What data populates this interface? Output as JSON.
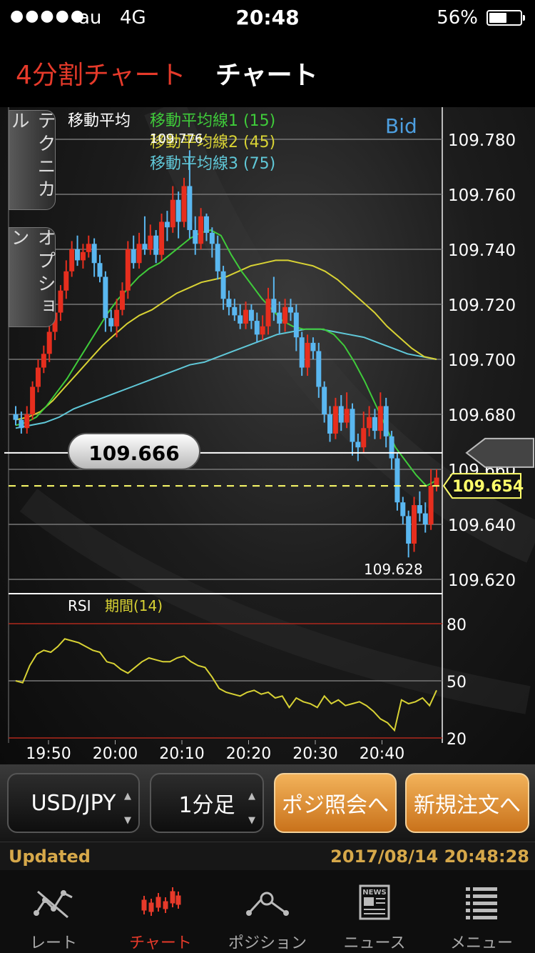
{
  "status_bar": {
    "signal": "●●●●●",
    "carrier": "au",
    "network": "4G",
    "time": "20:48",
    "battery": "56%",
    "battery_level": 0.56
  },
  "header": {
    "tab_split": "4分割チャート",
    "title": "チャート"
  },
  "side_tabs": [
    "テクニカル",
    "オプション"
  ],
  "chart": {
    "legend_prefix": "移動平均",
    "ma1": "移動平均線1 (15)",
    "ma2": "移動平均線2 (45)",
    "ma3": "移動平均線3 (75)",
    "bid_label": "Bid",
    "price_ticks": [
      "109.780",
      "109.760",
      "109.740",
      "109.720",
      "109.700",
      "109.680",
      "109.660",
      "109.640",
      "109.620"
    ],
    "high_label": "109.776",
    "low_label": "109.628",
    "crosshair_price": "109.666",
    "current_price": "109.654",
    "rsi_label": "RSI",
    "rsi_period": "期間(14)",
    "rsi_ticks": [
      "80",
      "50",
      "20"
    ],
    "time_ticks": [
      "19:50",
      "20:00",
      "20:10",
      "20:20",
      "20:30",
      "20:40"
    ],
    "colors": {
      "up": "#e62e1e",
      "down": "#5ab7f0",
      "ma1": "#3fcb3a",
      "ma2": "#d8d234",
      "ma3": "#60c8d8",
      "rsi": "#d8d234"
    }
  },
  "chart_data": {
    "type": "candlestick",
    "ylim": [
      109.615,
      109.79
    ],
    "rsi_ylim": [
      20,
      80
    ],
    "candles": [
      [
        109.68,
        109.678,
        109.683,
        109.676
      ],
      [
        109.678,
        109.675,
        109.681,
        109.673
      ],
      [
        109.675,
        109.68,
        109.683,
        109.673
      ],
      [
        109.68,
        109.69,
        109.692,
        109.678
      ],
      [
        109.69,
        109.697,
        109.7,
        109.688
      ],
      [
        109.697,
        109.702,
        109.705,
        109.695
      ],
      [
        109.702,
        109.71,
        109.712,
        109.699
      ],
      [
        109.71,
        109.717,
        109.72,
        109.707
      ],
      [
        109.717,
        109.725,
        109.727,
        109.714
      ],
      [
        109.725,
        109.732,
        109.736,
        109.722
      ],
      [
        109.732,
        109.74,
        109.743,
        109.73
      ],
      [
        109.74,
        109.736,
        109.745,
        109.734
      ],
      [
        109.736,
        109.739,
        109.742,
        109.733
      ],
      [
        109.739,
        109.742,
        109.745,
        109.737
      ],
      [
        109.742,
        109.735,
        109.744,
        109.73
      ],
      [
        109.735,
        109.73,
        109.738,
        109.728
      ],
      [
        109.73,
        109.715,
        109.732,
        109.71
      ],
      [
        109.715,
        109.712,
        109.718,
        109.71
      ],
      [
        109.712,
        109.718,
        109.722,
        109.708
      ],
      [
        109.718,
        109.725,
        109.728,
        109.716
      ],
      [
        109.725,
        109.74,
        109.743,
        109.722
      ],
      [
        109.74,
        109.735,
        109.745,
        109.733
      ],
      [
        109.735,
        109.742,
        109.746,
        109.733
      ],
      [
        109.742,
        109.74,
        109.752,
        109.738
      ],
      [
        109.74,
        109.745,
        109.749,
        109.738
      ],
      [
        109.745,
        109.738,
        109.747,
        109.735
      ],
      [
        109.738,
        109.75,
        109.753,
        109.736
      ],
      [
        109.75,
        109.748,
        109.754,
        109.743
      ],
      [
        109.748,
        109.758,
        109.763,
        109.746
      ],
      [
        109.758,
        109.75,
        109.761,
        109.744
      ],
      [
        109.75,
        109.763,
        109.766,
        109.748
      ],
      [
        109.763,
        109.747,
        109.776,
        109.744
      ],
      [
        109.747,
        109.742,
        109.752,
        109.738
      ],
      [
        109.742,
        109.752,
        109.755,
        109.74
      ],
      [
        109.752,
        109.746,
        109.753,
        109.743
      ],
      [
        109.746,
        109.742,
        109.748,
        109.737
      ],
      [
        109.742,
        109.732,
        109.745,
        109.729
      ],
      [
        109.732,
        109.722,
        109.734,
        109.718
      ],
      [
        109.722,
        109.719,
        109.725,
        109.716
      ],
      [
        109.719,
        109.716,
        109.722,
        109.714
      ],
      [
        109.716,
        109.713,
        109.72,
        109.711
      ],
      [
        109.713,
        109.718,
        109.721,
        109.711
      ],
      [
        109.718,
        109.714,
        109.72,
        109.711
      ],
      [
        109.714,
        109.709,
        109.717,
        109.706
      ],
      [
        109.709,
        109.712,
        109.716,
        109.707
      ],
      [
        109.712,
        109.722,
        109.726,
        109.709
      ],
      [
        109.722,
        109.717,
        109.73,
        109.714
      ],
      [
        109.717,
        109.713,
        109.721,
        109.709
      ],
      [
        109.713,
        109.719,
        109.722,
        109.71
      ],
      [
        109.719,
        109.717,
        109.722,
        109.714
      ],
      [
        109.717,
        109.708,
        109.72,
        109.703
      ],
      [
        109.708,
        109.697,
        109.71,
        109.694
      ],
      [
        109.697,
        109.706,
        109.709,
        109.694
      ],
      [
        109.706,
        109.703,
        109.708,
        109.7
      ],
      [
        109.703,
        109.69,
        109.706,
        109.686
      ],
      [
        109.69,
        109.68,
        109.692,
        109.677
      ],
      [
        109.68,
        109.673,
        109.683,
        109.67
      ],
      [
        109.673,
        109.683,
        109.686,
        109.671
      ],
      [
        109.683,
        109.677,
        109.687,
        109.674
      ],
      [
        109.677,
        109.682,
        109.688,
        109.675
      ],
      [
        109.682,
        109.67,
        109.684,
        109.665
      ],
      [
        109.67,
        109.668,
        109.673,
        109.663
      ],
      [
        109.668,
        109.675,
        109.681,
        109.666
      ],
      [
        109.675,
        109.679,
        109.683,
        109.672
      ],
      [
        109.679,
        109.674,
        109.682,
        109.671
      ],
      [
        109.674,
        109.683,
        109.688,
        109.671
      ],
      [
        109.683,
        109.672,
        109.686,
        109.668
      ],
      [
        109.672,
        109.664,
        109.674,
        109.66
      ],
      [
        109.664,
        109.648,
        109.666,
        109.645
      ],
      [
        109.648,
        109.643,
        109.65,
        109.64
      ],
      [
        109.643,
        109.633,
        109.645,
        109.628
      ],
      [
        109.633,
        109.647,
        109.65,
        109.63
      ],
      [
        109.647,
        109.644,
        109.652,
        109.641
      ],
      [
        109.644,
        109.64,
        109.648,
        109.637
      ],
      [
        109.64,
        109.654,
        109.66,
        109.638
      ],
      [
        109.654,
        109.657,
        109.66,
        109.652
      ]
    ],
    "ma1": [
      109.676,
      109.677,
      109.679,
      109.683,
      109.688,
      109.693,
      109.699,
      109.705,
      109.711,
      109.717,
      109.722,
      109.726,
      109.73,
      109.733,
      109.735,
      109.738,
      109.741,
      109.744,
      109.746,
      109.747,
      109.745,
      109.738,
      109.732,
      109.727,
      109.722,
      109.718,
      109.714,
      109.712,
      109.711,
      109.711,
      109.711,
      109.709,
      109.705,
      109.699,
      109.692,
      109.684,
      109.676,
      109.668,
      109.663,
      109.658,
      109.654,
      109.656
    ],
    "ma2": [
      109.678,
      109.679,
      109.681,
      109.685,
      109.69,
      109.695,
      109.7,
      109.705,
      109.709,
      109.713,
      109.716,
      109.718,
      109.721,
      109.724,
      109.726,
      109.728,
      109.729,
      109.73,
      109.732,
      109.734,
      109.735,
      109.736,
      109.736,
      109.735,
      109.734,
      109.732,
      109.729,
      109.725,
      109.721,
      109.717,
      109.712,
      109.708,
      109.704,
      109.701,
      109.7
    ],
    "ma3": [
      109.675,
      109.676,
      109.677,
      109.679,
      109.682,
      109.684,
      109.686,
      109.688,
      109.69,
      109.692,
      109.694,
      109.696,
      109.698,
      109.699,
      109.701,
      109.703,
      109.705,
      109.707,
      109.709,
      109.71,
      109.711,
      109.711,
      109.71,
      109.709,
      109.708,
      109.706,
      109.704,
      109.702,
      109.701,
      109.7
    ],
    "rsi": [
      50,
      49,
      58,
      64,
      66,
      65,
      68,
      72,
      71,
      70,
      68,
      66,
      65,
      60,
      59,
      56,
      54,
      57,
      60,
      62,
      61,
      60,
      60,
      62,
      63,
      60,
      58,
      57,
      52,
      46,
      44,
      43,
      42,
      44,
      45,
      43,
      44,
      41,
      42,
      36,
      41,
      39,
      38,
      36,
      42,
      38,
      40,
      37,
      38,
      39,
      37,
      34,
      30,
      28,
      24,
      40,
      38,
      39,
      41,
      37,
      45
    ]
  },
  "controls": {
    "pair": "USD/JPY",
    "timeframe": "1分足",
    "position_btn": "ポジ照会へ",
    "new_order_btn": "新規注文へ"
  },
  "updated": {
    "label": "Updated",
    "timestamp": "2017/08/14 20:48:28"
  },
  "tabs": [
    {
      "label": "レート",
      "icon": "rate-icon"
    },
    {
      "label": "チャート",
      "icon": "chart-icon"
    },
    {
      "label": "ポジション",
      "icon": "position-icon"
    },
    {
      "label": "ニュース",
      "icon": "news-icon"
    },
    {
      "label": "メニュー",
      "icon": "menu-icon"
    }
  ],
  "news_icon_text": "NEWS"
}
